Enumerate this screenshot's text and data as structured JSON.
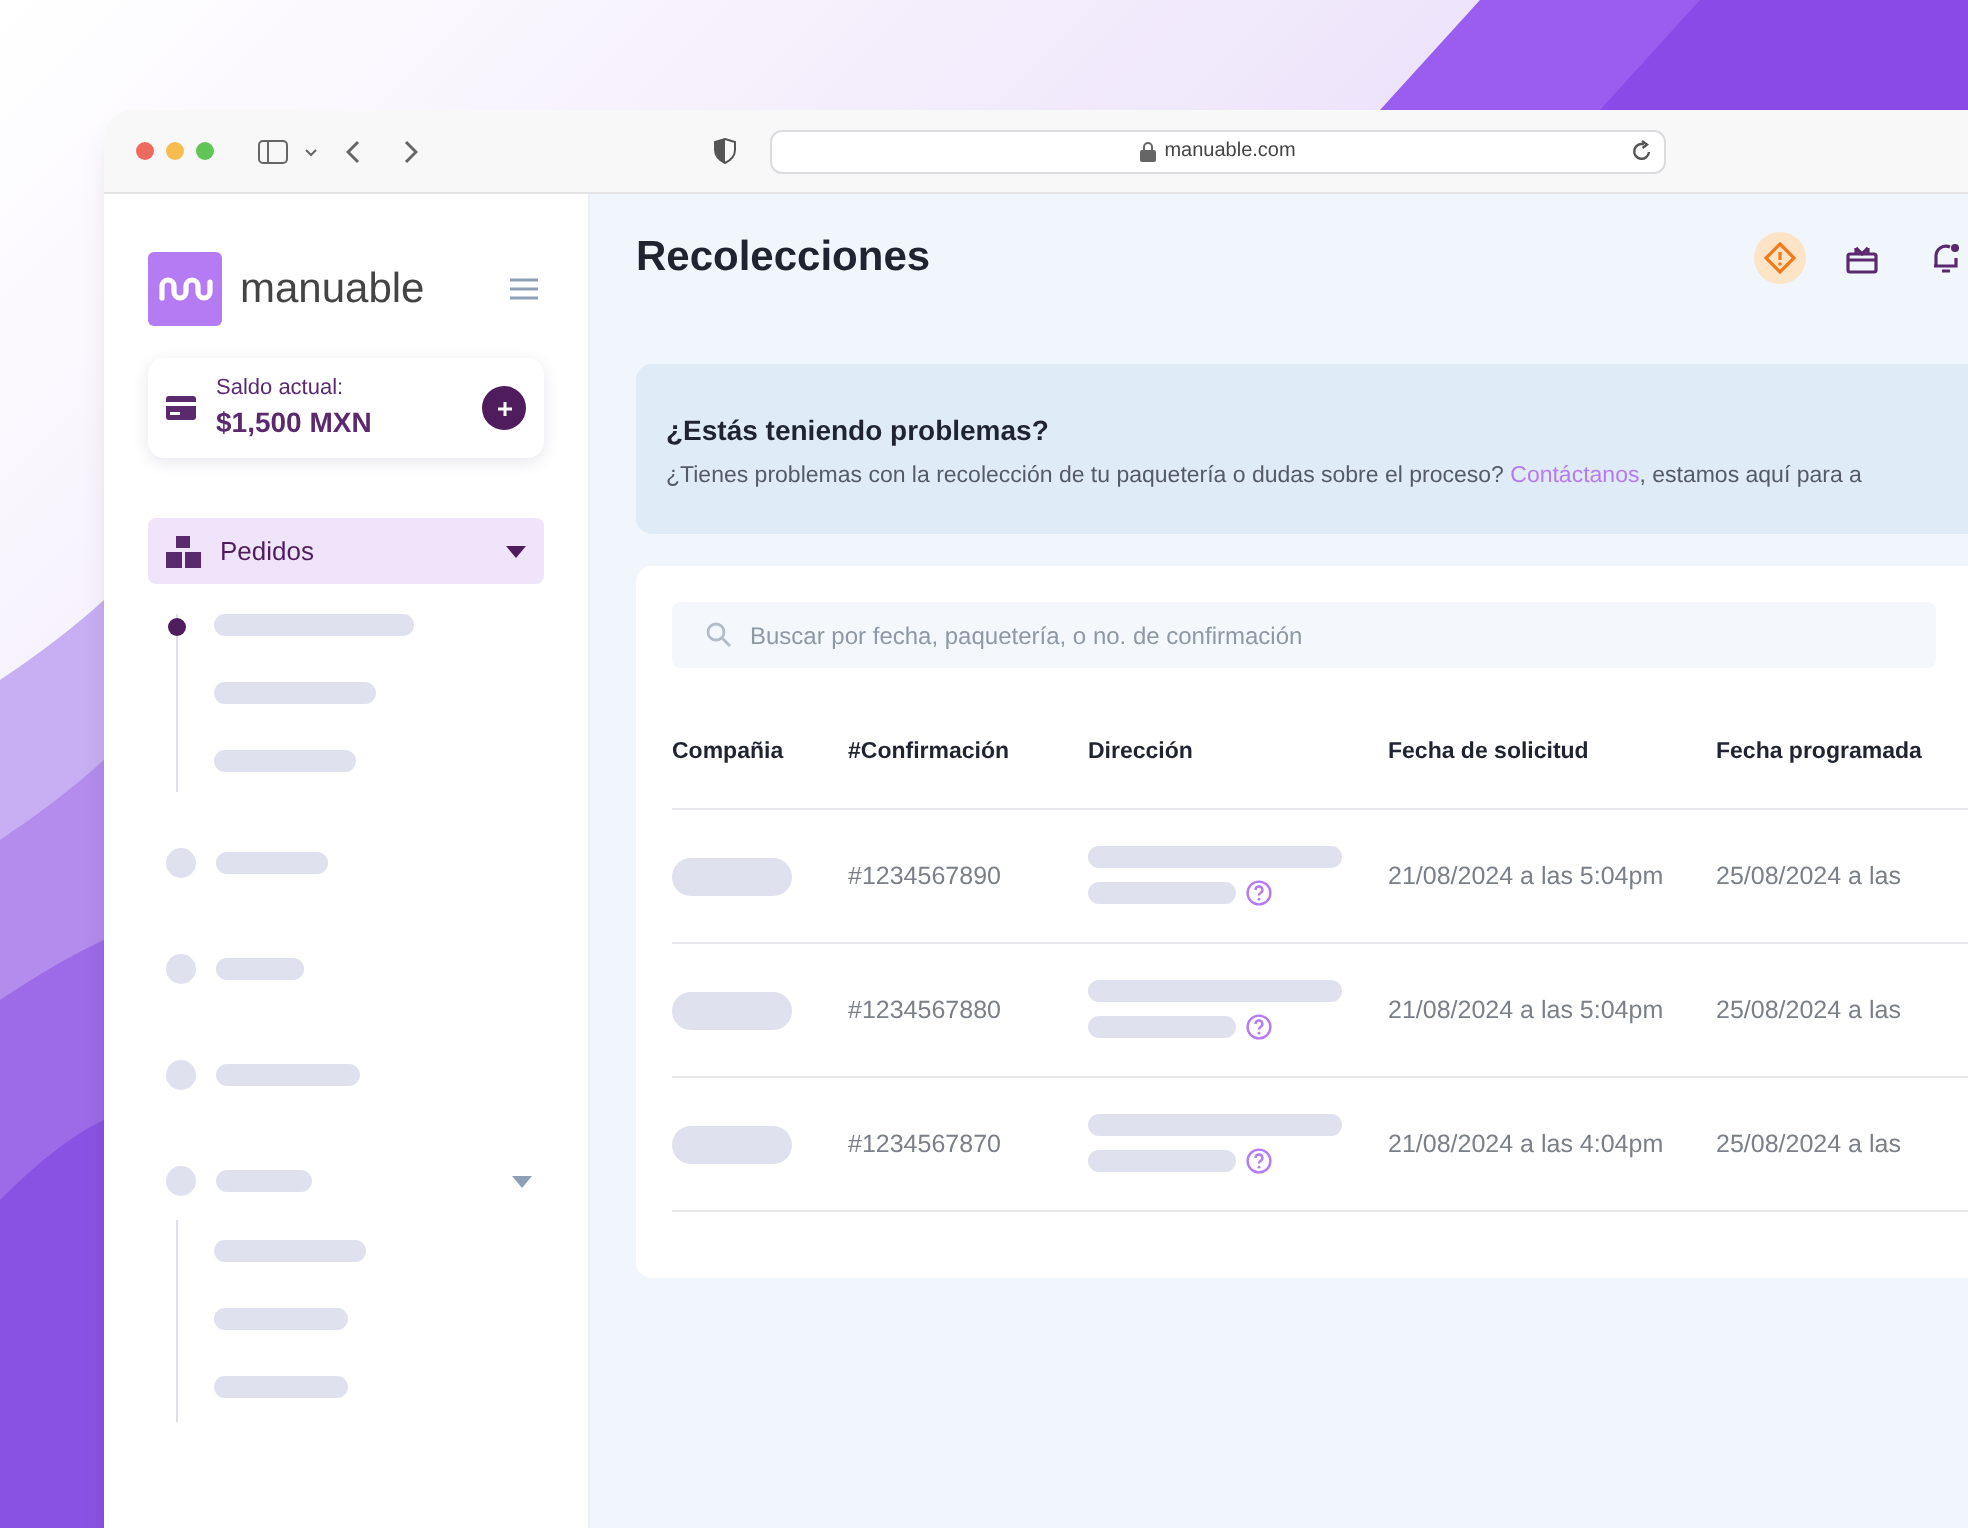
{
  "browser": {
    "url": "manuable.com"
  },
  "sidebar": {
    "logo": "manuable",
    "balance": {
      "label": "Saldo actual:",
      "amount": "$1,500 MXN"
    },
    "items": [
      {
        "label": "Pedidos",
        "selected": true,
        "expanded": true
      }
    ]
  },
  "page": {
    "title": "Recolecciones"
  },
  "banner": {
    "title": "¿Estás teniendo problemas?",
    "text_before": "¿Tienes problemas con la recolección de tu paquetería o dudas sobre el proceso? ",
    "link": "Contáctanos",
    "text_after": ", estamos aquí para a"
  },
  "search": {
    "placeholder": "Buscar por fecha, paquetería, o no. de confirmación"
  },
  "table": {
    "columns": [
      "Compañia",
      "#Confirmación",
      "Dirección",
      "Fecha de solicitud",
      "Fecha programada"
    ],
    "rows": [
      {
        "confirmation": "#1234567890",
        "requested": "21/08/2024 a las 5:04pm",
        "scheduled": "25/08/2024 a las"
      },
      {
        "confirmation": "#1234567880",
        "requested": "21/08/2024 a las 5:04pm",
        "scheduled": "25/08/2024 a las"
      },
      {
        "confirmation": "#1234567870",
        "requested": "21/08/2024 a las 4:04pm",
        "scheduled": "25/08/2024 a las"
      }
    ]
  }
}
